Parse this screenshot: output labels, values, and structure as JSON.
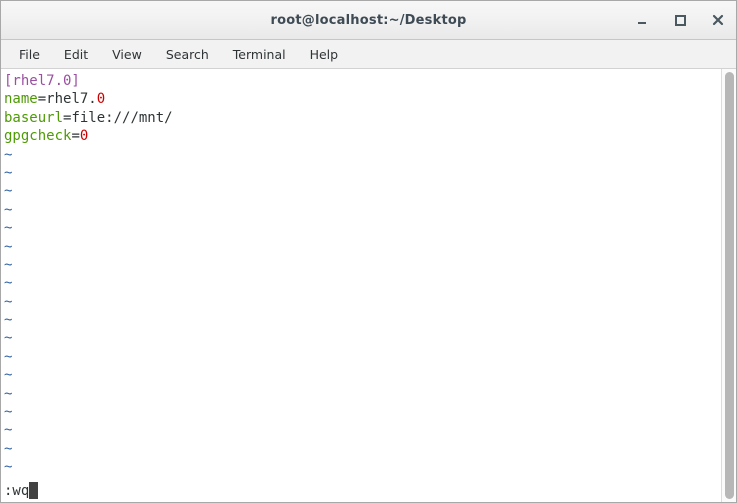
{
  "window": {
    "title": "root@localhost:~/Desktop",
    "controls": [
      {
        "name": "minimize",
        "label": "_"
      },
      {
        "name": "maximize",
        "label": "□"
      },
      {
        "name": "close",
        "label": "✕"
      }
    ]
  },
  "menubar": {
    "items": [
      {
        "label": "File"
      },
      {
        "label": "Edit"
      },
      {
        "label": "View"
      },
      {
        "label": "Search"
      },
      {
        "label": "Terminal"
      },
      {
        "label": "Help"
      }
    ]
  },
  "editor": {
    "application": "vim",
    "lines": [
      {
        "section": "[rhel7.0]"
      },
      {
        "key": "name",
        "eq": "=",
        "value": "rhel7.",
        "number": "0"
      },
      {
        "key": "baseurl",
        "eq": "=",
        "value": "file:///mnt/",
        "number": ""
      },
      {
        "key": "gpgcheck",
        "eq": "=",
        "value": "",
        "number": "0"
      }
    ],
    "empty_line_marker": "~",
    "empty_line_count": 18,
    "command_line": ":wq",
    "cursor": "block"
  },
  "colors": {
    "terminal_background": "#ffffff",
    "section_header": "#9a4fa0",
    "key": "#4e9a06",
    "plain_text": "#2e3436",
    "number": "#cc0000",
    "tilde": "#3465a4",
    "cursor": "#424242",
    "titlebar_text": "#3f4b54",
    "scrollbar_thumb": "#b7b7b7"
  },
  "scrollbar": {
    "name": "vertical-scrollbar",
    "thumb_position": "full"
  }
}
